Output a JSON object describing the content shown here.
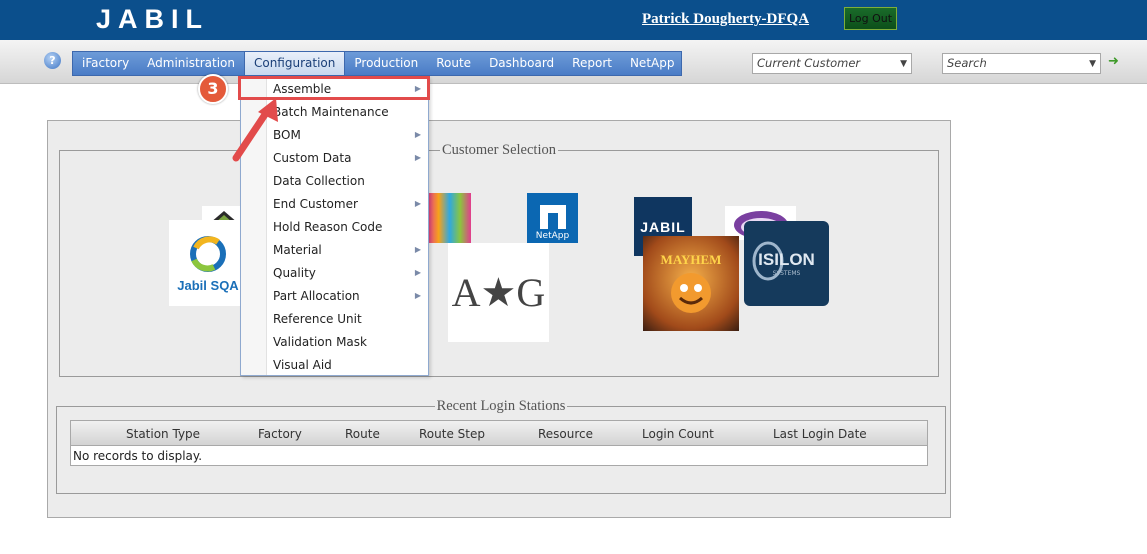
{
  "header": {
    "logo_text": "JABIL",
    "username": "Patrick Dougherty-DFQA",
    "logout_label": "Log Out"
  },
  "nav": {
    "help_label": "?",
    "items": [
      {
        "label": "iFactory"
      },
      {
        "label": "Administration"
      },
      {
        "label": "Configuration"
      },
      {
        "label": "Production"
      },
      {
        "label": "Route"
      },
      {
        "label": "Dashboard"
      },
      {
        "label": "Report"
      },
      {
        "label": "NetApp"
      }
    ],
    "current_customer_placeholder": "Current Customer",
    "search_placeholder": "Search"
  },
  "config_menu": {
    "items": [
      {
        "label": "Assemble",
        "has_submenu": true
      },
      {
        "label": "Batch Maintenance",
        "has_submenu": false
      },
      {
        "label": "BOM",
        "has_submenu": true
      },
      {
        "label": "Custom Data",
        "has_submenu": true
      },
      {
        "label": "Data Collection",
        "has_submenu": false
      },
      {
        "label": "End Customer",
        "has_submenu": true
      },
      {
        "label": "Hold Reason Code",
        "has_submenu": false
      },
      {
        "label": "Material",
        "has_submenu": true
      },
      {
        "label": "Quality",
        "has_submenu": true
      },
      {
        "label": "Part Allocation",
        "has_submenu": true
      },
      {
        "label": "Reference Unit",
        "has_submenu": false
      },
      {
        "label": "Validation Mask",
        "has_submenu": false
      },
      {
        "label": "Visual Aid",
        "has_submenu": false
      }
    ]
  },
  "annotation": {
    "step_number": "3",
    "color": "#e24b4b"
  },
  "customer_selection": {
    "legend": "Customer Selection",
    "logos": [
      {
        "text": "Jabil SQA"
      },
      {
        "text": "NetApp"
      },
      {
        "text": "A★G"
      },
      {
        "text": "JABIL"
      },
      {
        "text": "MAYHEM"
      },
      {
        "text": "ISILON"
      },
      {
        "text": "SYSTEMS"
      }
    ]
  },
  "recent_logins": {
    "legend": "Recent Login Stations",
    "columns": [
      "Station Type",
      "Factory",
      "Route",
      "Route Step",
      "Resource",
      "Login Count",
      "Last Login Date"
    ],
    "empty_text": "No records to display."
  },
  "colors": {
    "header_bg": "#0b4f8c",
    "menu_bg": "#4a7cc6",
    "accent_red": "#e24b4b"
  }
}
